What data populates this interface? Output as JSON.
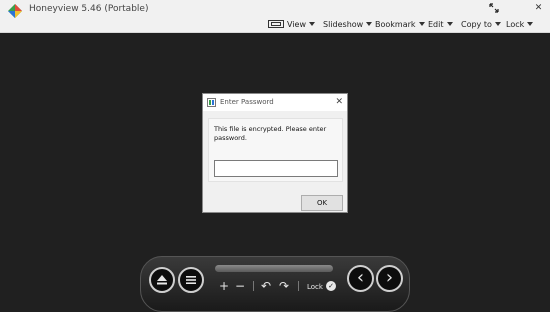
{
  "app": {
    "title": "Honeyview 5.46 (Portable)",
    "icon": "honeyview-logo-icon"
  },
  "window_controls": {
    "maximize_icon": "maximize-icon",
    "close_label": "✕"
  },
  "menu": {
    "view": "View",
    "slideshow": "Slideshow",
    "bookmark": "Bookmark",
    "edit": "Edit",
    "copy_to": "Copy to",
    "lock": "Lock"
  },
  "dialog": {
    "title": "Enter Password",
    "close": "✕",
    "message": "This file is encrypted. Please enter password.",
    "password_value": "",
    "ok": "OK"
  },
  "controls": {
    "zoom_in": "+",
    "zoom_out": "−",
    "rotate_left": "↶",
    "rotate_right": "↷",
    "lock_label": "Lock",
    "lock_check": "✓",
    "prev": "‹",
    "next": "›"
  },
  "colors": {
    "background": "#202020",
    "dialog_bg": "#f0f0f0",
    "titlebar_bg": "#f1f1f1"
  }
}
